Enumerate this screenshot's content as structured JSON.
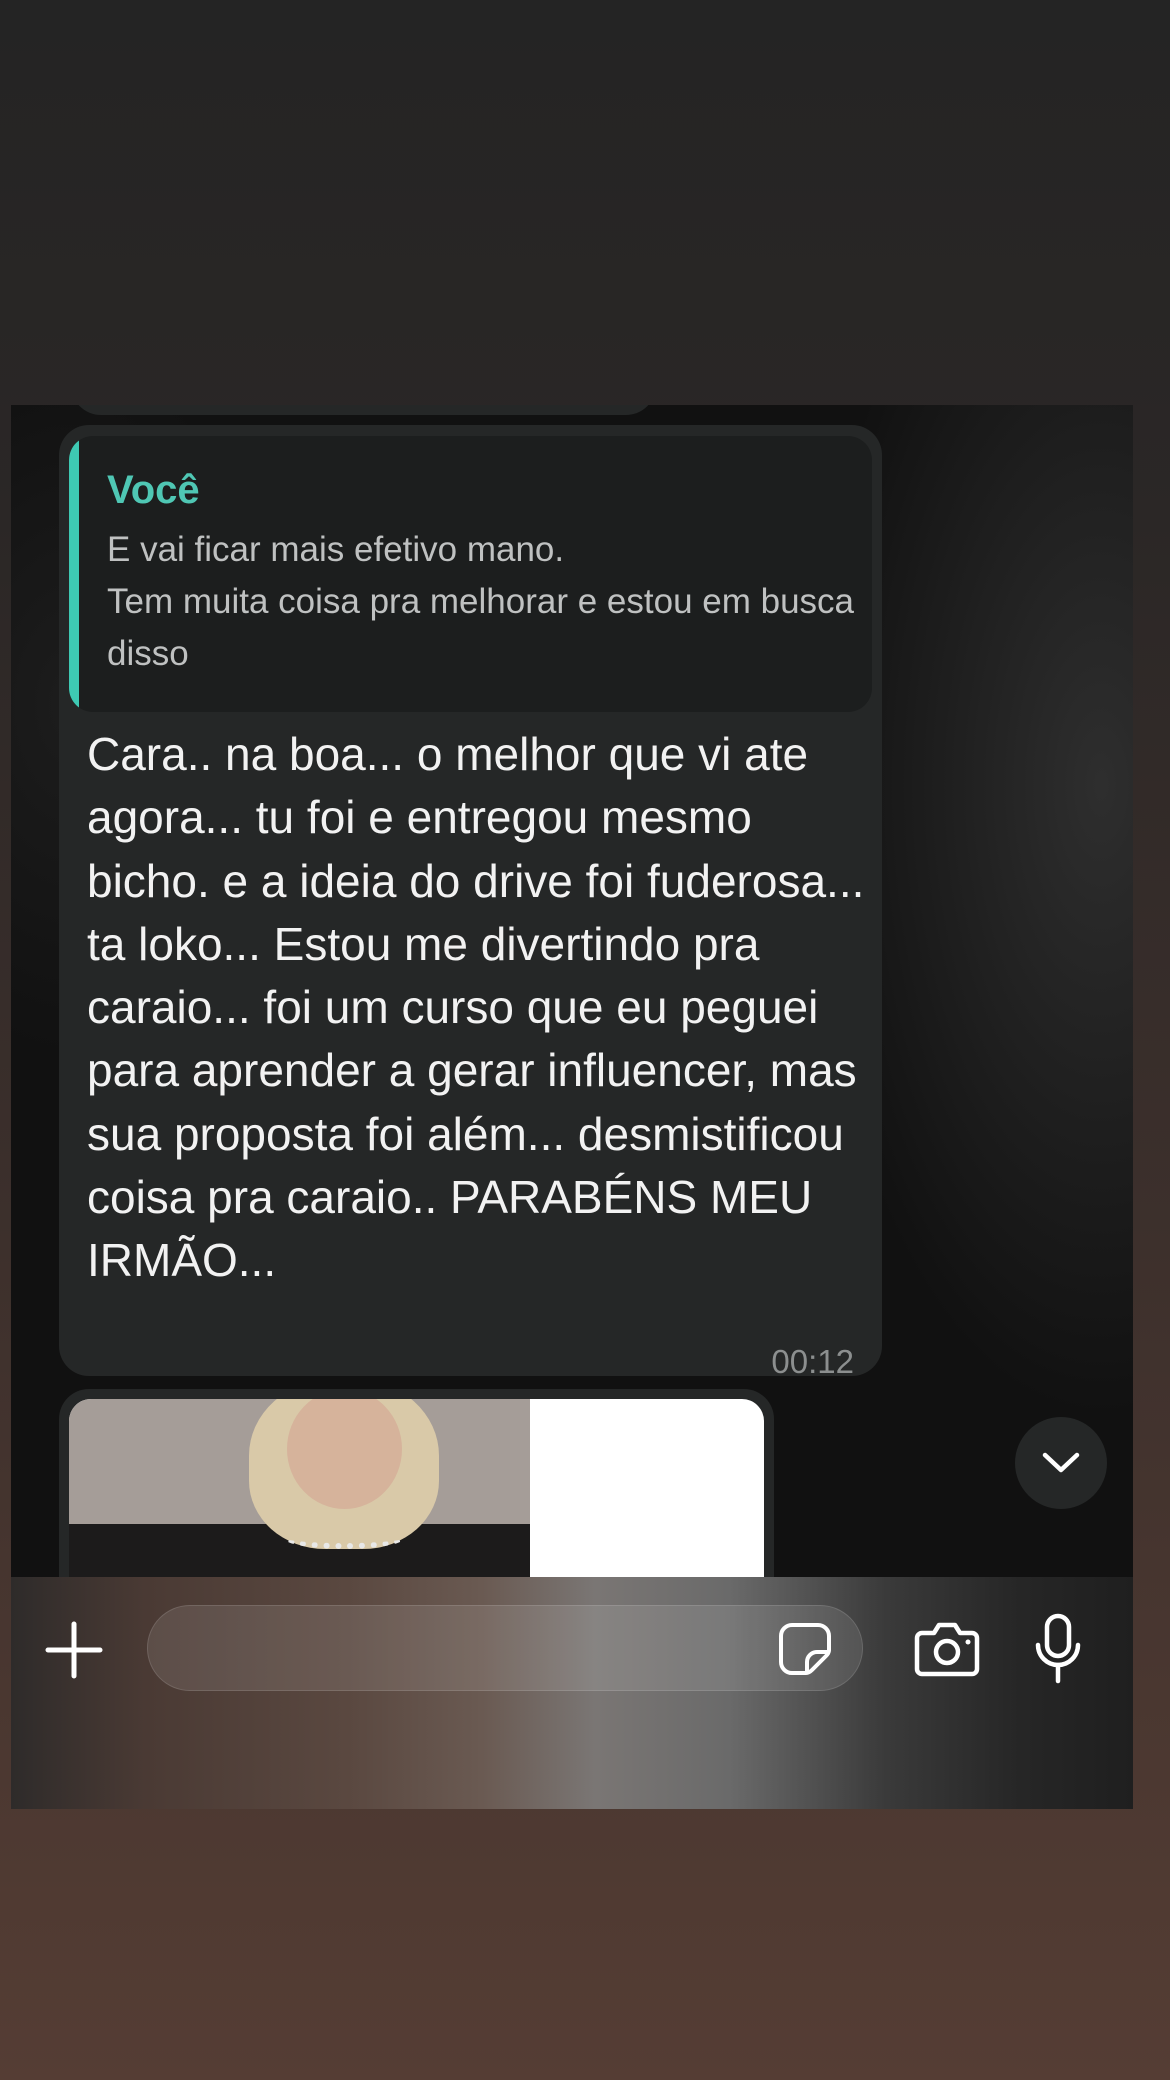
{
  "quoted_message": {
    "author": "Você",
    "text": "E vai ficar mais efetivo mano.\nTem muita coisa pra melhorar e estou em busca disso",
    "accent_color": "#3ec9b3"
  },
  "message": {
    "text": "Cara.. na boa... o melhor que vi ate agora... tu foi e entregou mesmo bicho. e a ideia do drive foi fuderosa... ta loko... Estou me divertindo pra caraio... foi um curso que eu peguei para aprender a gerar influencer, mas sua proposta foi além... desmistificou coisa pra caraio.. PARABÉNS MEU IRMÃO...",
    "time": "00:12"
  },
  "image_message": {
    "content": "photo-thumbnail"
  },
  "icons": {
    "scroll_down": "chevron-down-icon",
    "add": "plus-icon",
    "sticker": "sticker-icon",
    "camera": "camera-icon",
    "microphone": "microphone-icon"
  },
  "colors": {
    "bubble": "#252727",
    "quote_background": "#1c1e1e",
    "chat_background": "#111111"
  }
}
